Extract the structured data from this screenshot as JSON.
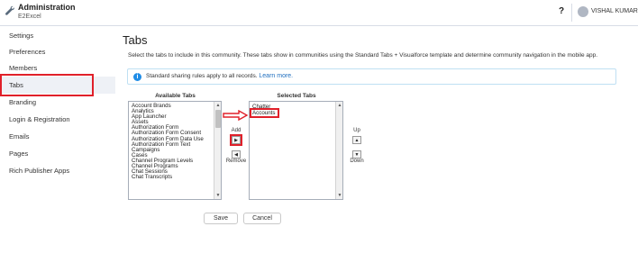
{
  "header": {
    "title": "Administration",
    "subtitle": "E2Excel",
    "help_label": "?",
    "user_name": "VISHAL KUMAR"
  },
  "sidebar": {
    "items": [
      {
        "label": "Settings"
      },
      {
        "label": "Preferences"
      },
      {
        "label": "Members"
      },
      {
        "label": "Tabs",
        "active": true
      },
      {
        "label": "Branding"
      },
      {
        "label": "Login & Registration"
      },
      {
        "label": "Emails"
      },
      {
        "label": "Pages"
      },
      {
        "label": "Rich Publisher Apps"
      }
    ]
  },
  "main": {
    "title": "Tabs",
    "description": "Select the tabs to include in this community. These tabs show in communities using the Standard Tabs + Visualforce template and determine community navigation in the mobile app.",
    "info_text": "Standard sharing rules apply to all records.",
    "info_link": "Learn more.",
    "available_label": "Available Tabs",
    "selected_label": "Selected Tabs",
    "available_tabs": [
      "Account Brands",
      "Analytics",
      "App Launcher",
      "Assets",
      "Authorization Form",
      "Authorization Form Consent",
      "Authorization Form Data Use",
      "Authorization Form Text",
      "Campaigns",
      "Cases",
      "Channel Program Levels",
      "Channel Programs",
      "Chat Sessions",
      "Chat Transcripts"
    ],
    "selected_tabs": [
      "Chatter",
      "Accounts"
    ],
    "add_label": "Add",
    "remove_label": "Remove",
    "up_label": "Up",
    "down_label": "Down",
    "save_label": "Save",
    "cancel_label": "Cancel"
  },
  "colors": {
    "highlight": "#e0202a",
    "link": "#1f6ebf",
    "info": "#1f8ce6"
  }
}
